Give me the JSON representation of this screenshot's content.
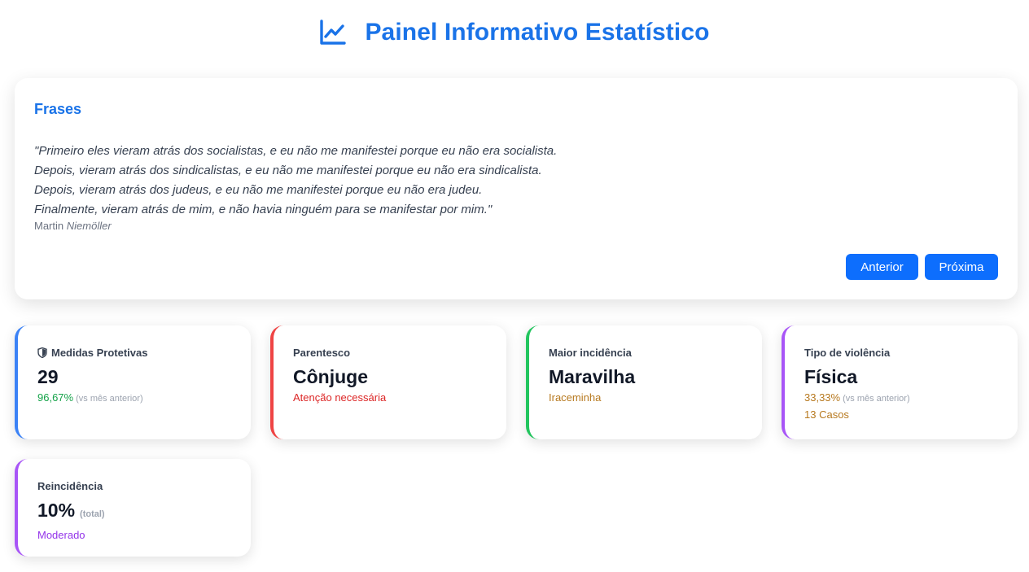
{
  "header": {
    "icon": "line-chart-icon",
    "title": "Painel Informativo Estatístico",
    "accent_color": "#1a73e8"
  },
  "quote_card": {
    "heading": "Frases",
    "lines": [
      "\"Primeiro eles vieram atrás dos socialistas, e eu não me manifestei porque eu não era socialista.",
      "Depois, vieram atrás dos sindicalistas, e eu não me manifestei porque eu não era sindicalista.",
      "Depois, vieram atrás dos judeus, e eu não me manifestei porque eu não era judeu.",
      "Finalmente, vieram atrás de mim, e não havia ninguém para se manifestar por mim.\""
    ],
    "author_first": "Martin",
    "author_last": "Niemöller",
    "prev_label": "Anterior",
    "next_label": "Próxima",
    "button_color": "#0d6efd"
  },
  "stats": {
    "medidas": {
      "icon": "shield-icon",
      "label": "Medidas Protetivas",
      "value": "29",
      "change": "96,67%",
      "note": "(vs mês anterior)",
      "border_color": "#3b82f6"
    },
    "parentesco": {
      "label": "Parentesco",
      "value": "Cônjuge",
      "sub": "Atenção necessária",
      "border_color": "#ef4444"
    },
    "incidencia": {
      "label": "Maior incidência",
      "value": "Maravilha",
      "sub": "Iraceminha",
      "border_color": "#22c55e"
    },
    "violencia": {
      "label": "Tipo de violência",
      "value": "Física",
      "change": "33,33%",
      "note": "(vs mês anterior)",
      "cases": "13 Casos",
      "border_color": "#a855f7"
    },
    "reincidencia": {
      "label": "Reincidência",
      "value": "10%",
      "small": "(total)",
      "sub": "Moderado",
      "border_color": "#a855f7"
    }
  }
}
